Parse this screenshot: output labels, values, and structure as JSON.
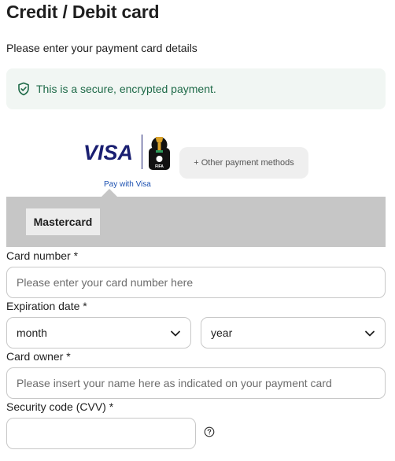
{
  "page": {
    "title": "Credit / Debit card",
    "subtitle": "Please enter your payment card details"
  },
  "secure_notice": {
    "text": "This is a secure, encrypted payment.",
    "icon": "shield-check-icon",
    "color": "#1e6a48"
  },
  "payment_methods": {
    "visa_logo_text": "VISA",
    "visa_caption": "Pay with Visa",
    "fifa_logo_text": "FIFA",
    "other_methods_label": "+ Other payment methods",
    "selected_method": "Mastercard"
  },
  "form": {
    "card_number": {
      "label": "Card number *",
      "placeholder": "Please enter your card number here",
      "value": ""
    },
    "expiration": {
      "label": "Expiration date *",
      "month": "month",
      "year": "year"
    },
    "card_owner": {
      "label": "Card owner *",
      "placeholder": "Please insert your name here as indicated on your payment card",
      "value": ""
    },
    "cvv": {
      "label": "Security code (CVV) *",
      "value": "",
      "help_icon": "question-circle-icon"
    }
  },
  "colors": {
    "visa_blue": "#1a1f71",
    "secure_bg": "#f1f6f3",
    "band_grey": "#c6c6c6"
  }
}
